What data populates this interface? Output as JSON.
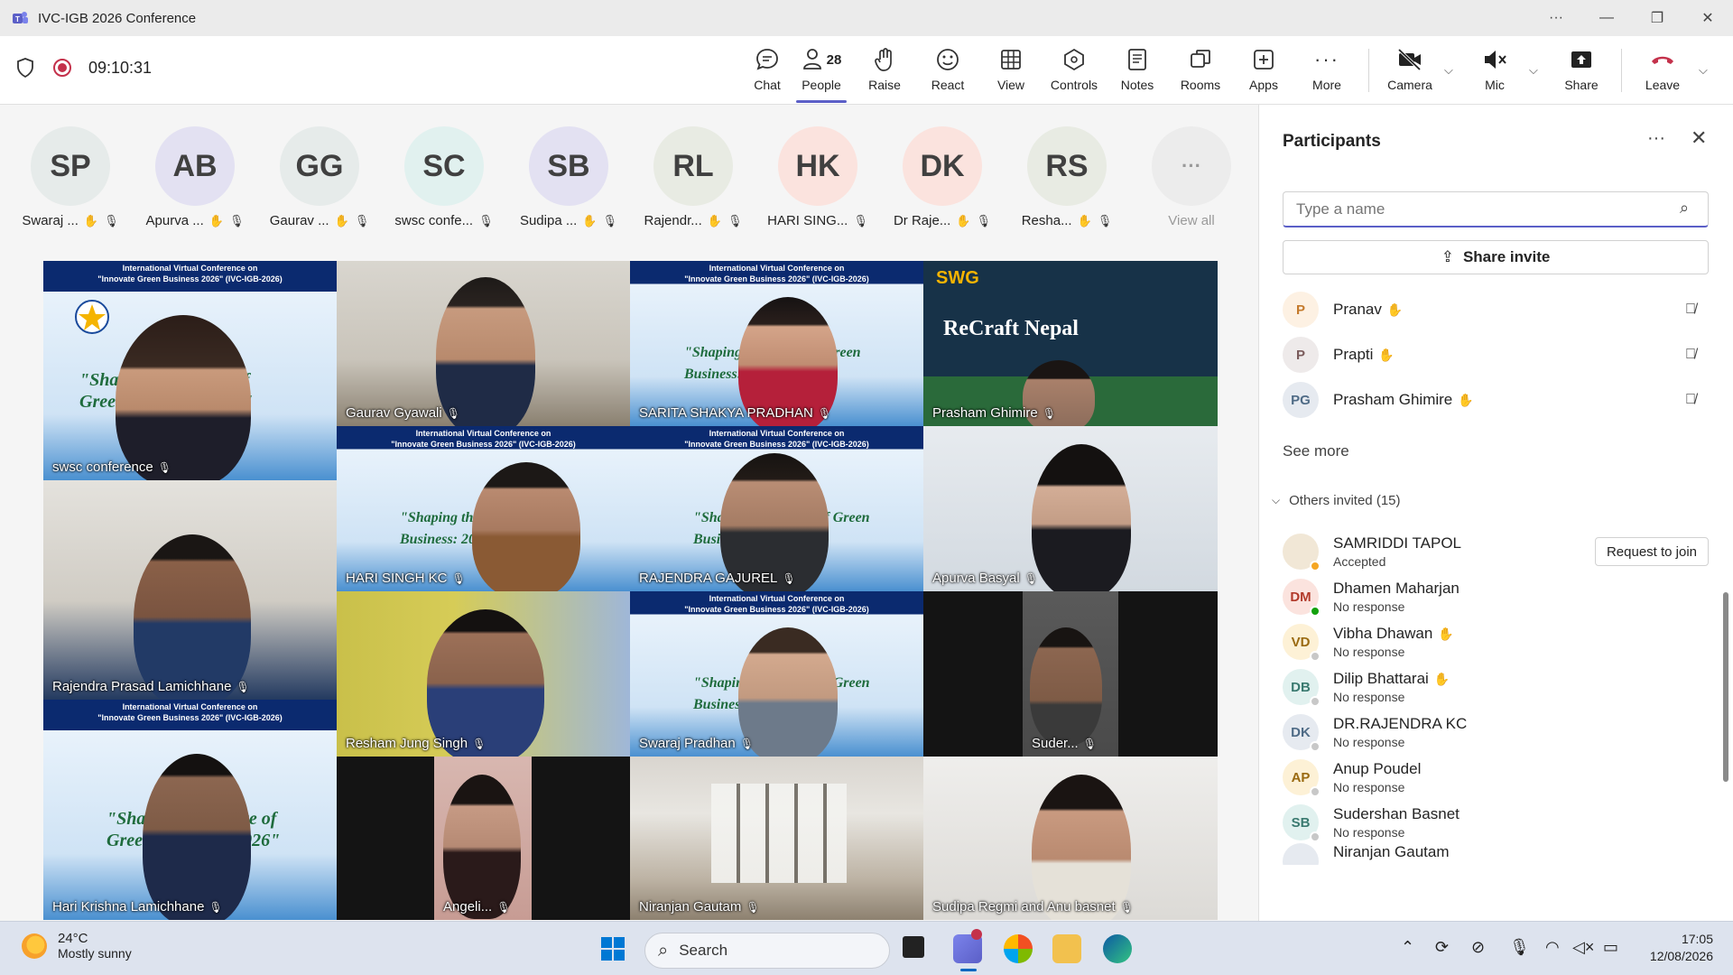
{
  "window": {
    "title": "IVC-IGB 2026 Conference"
  },
  "meeting": {
    "timer": "09:10:31"
  },
  "toolbar": {
    "chat": "Chat",
    "people": "People",
    "people_count": "28",
    "raise": "Raise",
    "react": "React",
    "view": "View",
    "controls": "Controls",
    "notes": "Notes",
    "rooms": "Rooms",
    "apps": "Apps",
    "more": "More",
    "camera": "Camera",
    "mic": "Mic",
    "share": "Share",
    "leave": "Leave"
  },
  "avatar_strip": {
    "items": [
      {
        "initials": "SP",
        "name": "Swaraj ...",
        "bg": "#e6ebea"
      },
      {
        "initials": "AB",
        "name": "Apurva ...",
        "bg": "#e3e1f2"
      },
      {
        "initials": "GG",
        "name": "Gaurav ...",
        "bg": "#e6ebea"
      },
      {
        "initials": "SC",
        "name": "swsc confe...",
        "bg": "#e1f1ef"
      },
      {
        "initials": "SB",
        "name": "Sudipa ...",
        "bg": "#e3e1f2"
      },
      {
        "initials": "RL",
        "name": "Rajendr...",
        "bg": "#e8ebe3"
      },
      {
        "initials": "HK",
        "name": "HARI SING...",
        "bg": "#fbe3de"
      },
      {
        "initials": "DK",
        "name": "Dr Raje...",
        "bg": "#fbe3de"
      },
      {
        "initials": "RS",
        "name": "Resha...",
        "bg": "#e8ebe3"
      }
    ],
    "view_all": "View all"
  },
  "video_grid": {
    "banner_line1": "International Virtual Conference on",
    "banner_line2": "\"Innovate Green Business 2026\" (IVC-IGB-2026)",
    "shaping_text": "\"Shaping the future of Green Business: 2026\"",
    "recraft_title": "ReCraft Nepal",
    "recraft_brand": "SWG",
    "tiles": [
      "swsc conference",
      "Gaurav Gyawali",
      "SARITA SHAKYA PRADHAN",
      "Prasham Ghimire",
      "HARI SINGH KC",
      "RAJENDRA GAJUREL",
      "Apurva Basyal",
      "Rajendra Prasad Lamichhane",
      "Resham Jung Singh",
      "Swaraj Pradhan",
      "Suder...",
      "Hari Krishna Lamichhane",
      "Angeli...",
      "Niranjan Gautam",
      "Sudipa Regmi and Anu basnet"
    ]
  },
  "participants_panel": {
    "title": "Participants",
    "search_placeholder": "Type a name",
    "share_invite": "Share invite",
    "in_meeting": [
      {
        "initials": "P",
        "name": "Pranav"
      },
      {
        "initials": "P",
        "name": "Prapti"
      },
      {
        "initials": "PG",
        "name": "Prasham Ghimire"
      }
    ],
    "see_more": "See more",
    "others_header": "Others invited (15)",
    "others": [
      {
        "initials": "",
        "name": "SAMRIDDI TAPOL",
        "status": "Accepted",
        "action": "Request to join"
      },
      {
        "initials": "DM",
        "name": "Dhamen Maharjan",
        "status": "No response"
      },
      {
        "initials": "VD",
        "name": "Vibha Dhawan",
        "status": "No response"
      },
      {
        "initials": "DB",
        "name": "Dilip Bhattarai",
        "status": "No response"
      },
      {
        "initials": "DK",
        "name": "DR.RAJENDRA KC",
        "status": "No response"
      },
      {
        "initials": "AP",
        "name": "Anup Poudel",
        "status": "No response"
      },
      {
        "initials": "SB",
        "name": "Sudershan Basnet",
        "status": "No response"
      },
      {
        "initials": "",
        "name": "Niranjan Gautam",
        "status": ""
      }
    ]
  },
  "taskbar": {
    "temperature": "24°C",
    "weather": "Mostly sunny",
    "search": "Search",
    "time": "17:05",
    "date": "12/08/2026"
  },
  "colors": {
    "accent": "#5b5fc7",
    "leave": "#c4314b"
  }
}
